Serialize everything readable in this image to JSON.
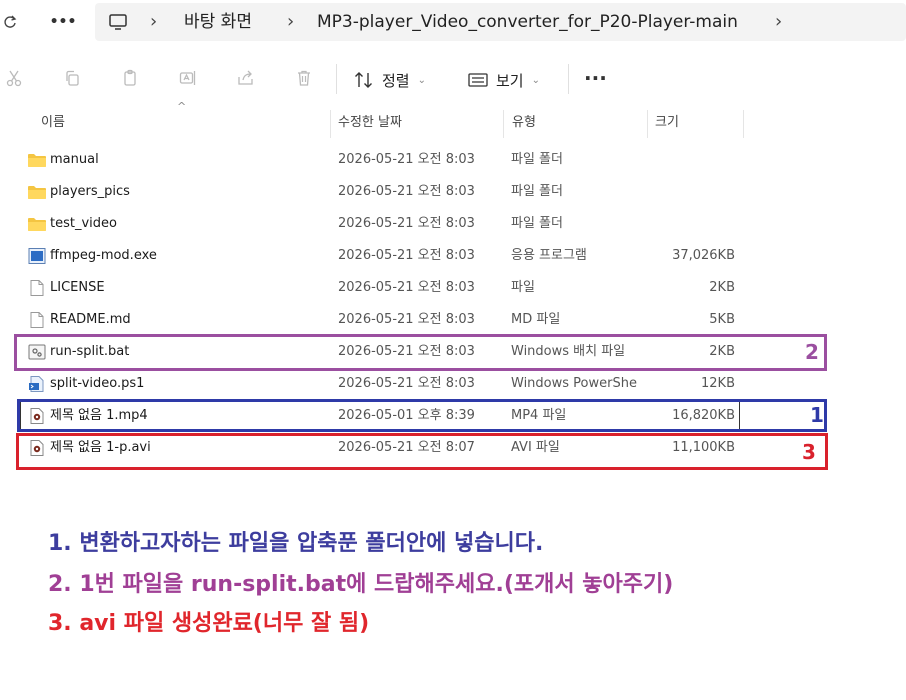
{
  "breadcrumbs": [
    "바탕 화면",
    "MP3-player_Video_converter_for_P20-Player-main"
  ],
  "address_bar": {
    "more_label": "•••"
  },
  "toolbar": {
    "sort_label": "정렬",
    "view_label": "보기",
    "more_label": "···"
  },
  "columns": {
    "name": "이름",
    "date": "수정한 날짜",
    "type": "유형",
    "size": "크기"
  },
  "files": [
    {
      "name": "manual",
      "date": "2026-05-21 오전 8:03",
      "type": "파일 폴더",
      "size": "",
      "icon": "folder-icon"
    },
    {
      "name": "players_pics",
      "date": "2026-05-21 오전 8:03",
      "type": "파일 폴더",
      "size": "",
      "icon": "folder-icon"
    },
    {
      "name": "test_video",
      "date": "2026-05-21 오전 8:03",
      "type": "파일 폴더",
      "size": "",
      "icon": "folder-icon"
    },
    {
      "name": "ffmpeg-mod.exe",
      "date": "2026-05-21 오전 8:03",
      "type": "응용 프로그램",
      "size": "37,026KB",
      "icon": "exe-icon"
    },
    {
      "name": "LICENSE",
      "date": "2026-05-21 오전 8:03",
      "type": "파일",
      "size": "2KB",
      "icon": "file-icon"
    },
    {
      "name": "README.md",
      "date": "2026-05-21 오전 8:03",
      "type": "MD 파일",
      "size": "5KB",
      "icon": "file-icon"
    },
    {
      "name": "run-split.bat",
      "date": "2026-05-21 오전 8:03",
      "type": "Windows 배치 파일",
      "size": "2KB",
      "icon": "bat-icon"
    },
    {
      "name": "split-video.ps1",
      "date": "2026-05-21 오전 8:03",
      "type": "Windows PowerShell",
      "size": "12KB",
      "icon": "ps1-icon"
    },
    {
      "name": "제목 없음 1.mp4",
      "date": "2026-05-01 오후 8:39",
      "type": "MP4 파일",
      "size": "16,820KB",
      "icon": "video-icon"
    },
    {
      "name": "제목 없음 1-p.avi",
      "date": "2026-05-21 오전 8:07",
      "type": "AVI 파일",
      "size": "11,100KB",
      "icon": "video-icon"
    }
  ],
  "highlights": [
    {
      "label": "2",
      "color": "#9b4fa0"
    },
    {
      "label": "1",
      "color": "#2e3aa8"
    },
    {
      "label": "3",
      "color": "#d9212c"
    }
  ],
  "instructions": [
    {
      "text": "1. 변환하고자하는 파일을 압축푼 폴더안에 넣습니다.",
      "color": "#3d3d9e"
    },
    {
      "text": "2. 1번 파일을 run-split.bat에 드랍해주세요.(포개서 놓아주기)",
      "color": "#a03f95"
    },
    {
      "text": "3. avi 파일 생성완료(너무 잘 됨)",
      "color": "#e0262c"
    }
  ]
}
